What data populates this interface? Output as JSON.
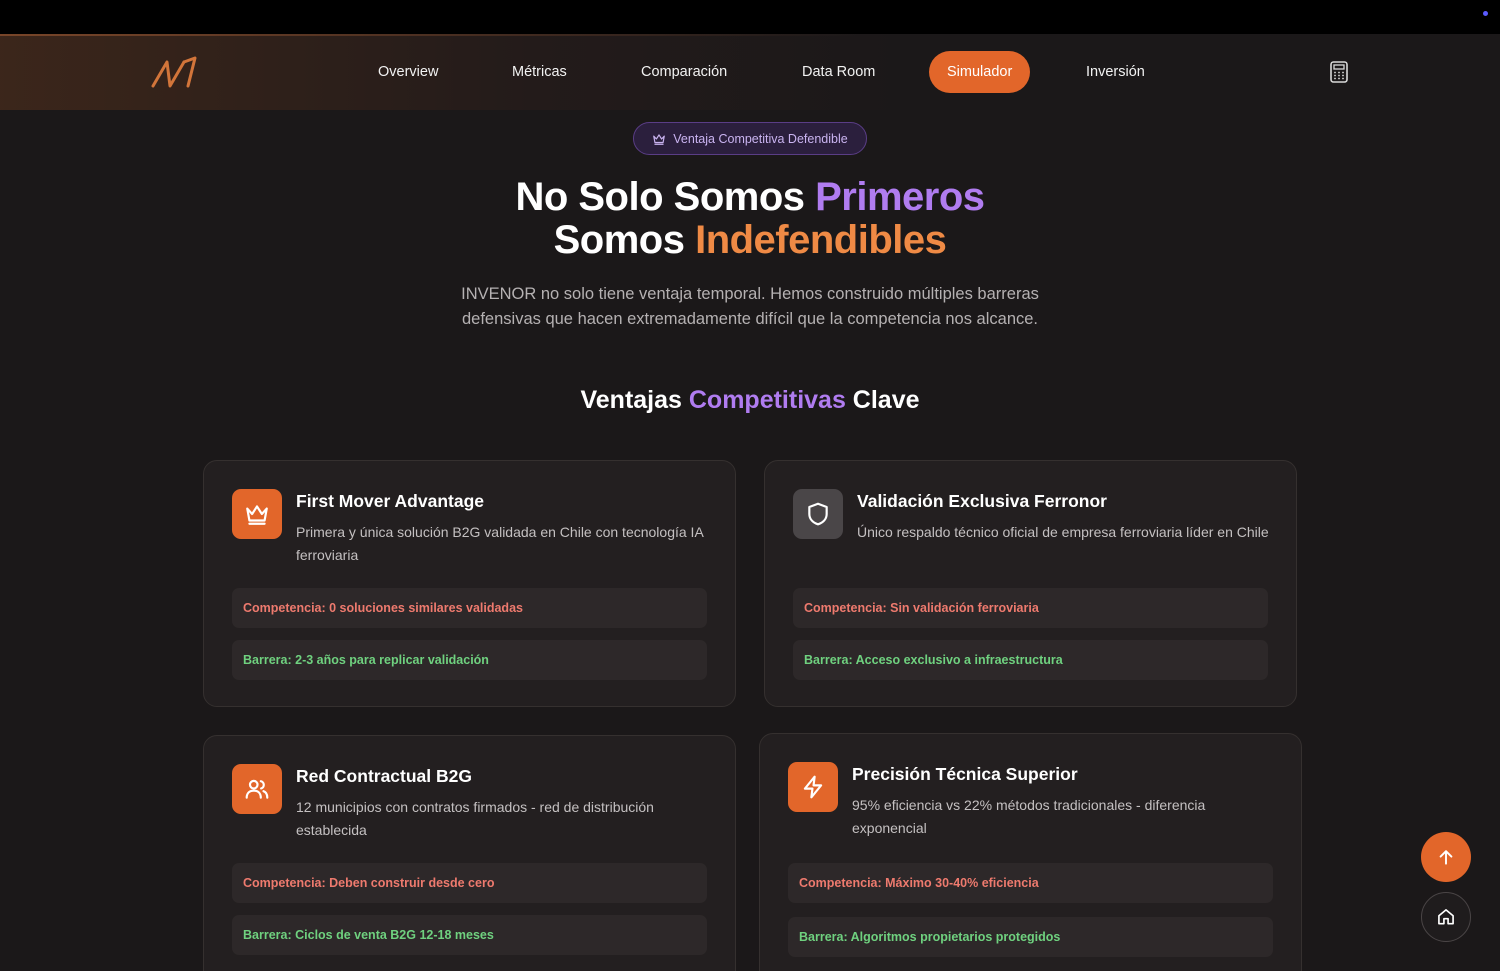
{
  "colors": {
    "accent": "#e2662a",
    "purple": "#b07cf0",
    "orange_text": "#ef8a45",
    "competition": "#ee7a6e",
    "barrier": "#6fd17f",
    "background": "#1b1819"
  },
  "nav": {
    "logo_icon": "brand-logo-icon",
    "items": [
      "Overview",
      "Métricas",
      "Comparación",
      "Data Room",
      "Simulador",
      "Inversión"
    ],
    "active": "Simulador",
    "calculator_icon": "calculator-icon"
  },
  "badge": {
    "icon": "crown-icon",
    "label": "Ventaja Competitiva Defendible"
  },
  "hero": {
    "line1_a": "No Solo Somos ",
    "line1_b": "Primeros",
    "line2_a": "Somos ",
    "line2_b": "Indefendibles",
    "subtitle": "INVENOR no solo tiene ventaja temporal. Hemos construido múltiples barreras defensivas que hacen extremadamente difícil que la competencia nos alcance."
  },
  "section": {
    "a": "Ventajas ",
    "b": "Competitivas",
    "c": " Clave"
  },
  "cards": [
    {
      "icon": "crown-icon",
      "title": "First Mover Advantage",
      "desc": "Primera y única solución B2G validada en Chile con tecnología IA ferroviaria",
      "competition": "Competencia: 0 soluciones similares validadas",
      "barrier": "Barrera: 2-3 años para replicar validación"
    },
    {
      "icon": "shield-icon",
      "title": "Validación Exclusiva Ferronor",
      "desc": "Único respaldo técnico oficial de empresa ferroviaria líder en Chile",
      "competition": "Competencia: Sin validación ferroviaria",
      "barrier": "Barrera: Acceso exclusivo a infraestructura"
    },
    {
      "icon": "users-icon",
      "title": "Red Contractual B2G",
      "desc": "12 municipios con contratos firmados - red de distribución establecida",
      "competition": "Competencia: Deben construir desde cero",
      "barrier": "Barrera: Ciclos de venta B2G 12-18 meses"
    },
    {
      "icon": "lightning-icon",
      "title": "Precisión Técnica Superior",
      "desc": "95% eficiencia vs 22% métodos tradicionales - diferencia exponencial",
      "competition": "Competencia: Máximo 30-40% eficiencia",
      "barrier": "Barrera: Algoritmos propietarios protegidos"
    }
  ],
  "fabs": {
    "up_icon": "arrow-up-icon",
    "home_icon": "home-icon"
  }
}
